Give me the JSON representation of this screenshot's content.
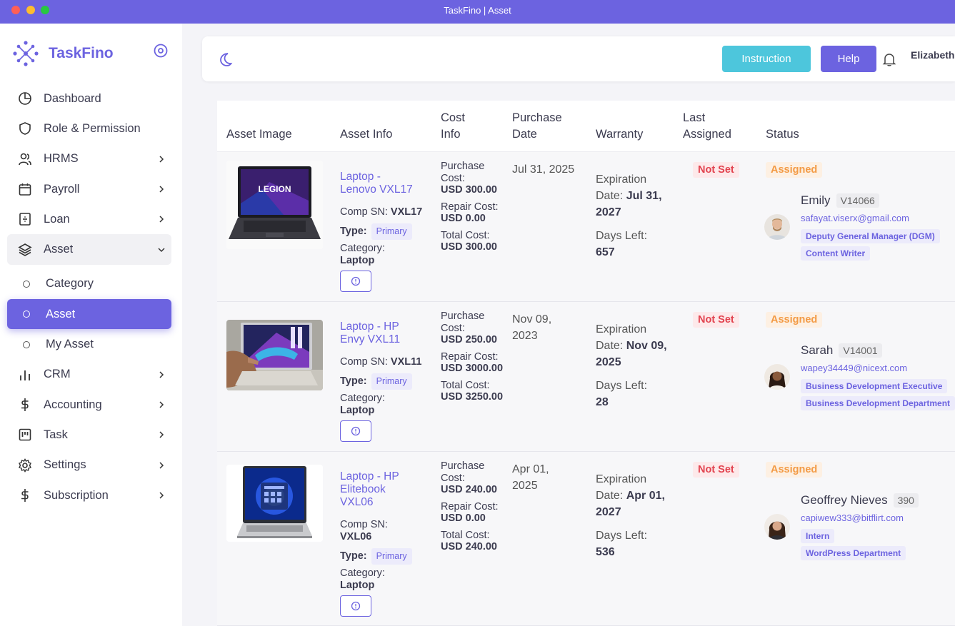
{
  "window": {
    "title": "TaskFino | Asset"
  },
  "brand": {
    "name": "TaskFino"
  },
  "nav": {
    "dashboard": "Dashboard",
    "role": "Role & Permission",
    "hrms": "HRMS",
    "payroll": "Payroll",
    "loan": "Loan",
    "asset": "Asset",
    "category": "Category",
    "asset_sub": "Asset",
    "my_asset": "My Asset",
    "crm": "CRM",
    "accounting": "Accounting",
    "task": "Task",
    "settings": "Settings",
    "subscription": "Subscription"
  },
  "header": {
    "instruction": "Instruction",
    "help": "Help",
    "user": "Elizabeth"
  },
  "table": {
    "columns": {
      "asset_image": "Asset Image",
      "asset_info": "Asset Info",
      "cost_l1": "Cost",
      "cost_l2": "Info",
      "purchase_l1": "Purchase",
      "purchase_l2": "Date",
      "warranty": "Warranty",
      "last_l1": "Last",
      "last_l2": "Assigned",
      "status": "Status"
    },
    "rows": [
      {
        "title_l1": "Laptop -",
        "title_l2": "Lenovo VXL17",
        "comp_sn_label": "Comp SN:",
        "comp_sn": "VXL17",
        "type_label": "Type:",
        "type": "Primary",
        "category_label": "Category:",
        "category": "Laptop",
        "image_text": "LEGION",
        "purchase_cost_label": "Purchase Cost:",
        "purchase_cost": "USD 300.00",
        "repair_cost_label": "Repair Cost:",
        "repair_cost": "USD 0.00",
        "total_cost_label": "Total Cost:",
        "total_cost": "USD 300.00",
        "purchase_date": "Jul 31, 2025",
        "expiration_label": "Expiration Date:",
        "expiration": "Jul 31, 2027",
        "days_left_label": "Days Left:",
        "days_left": "657",
        "last_assigned": "Not Set",
        "status": "Assigned",
        "emp_name": "Emily",
        "emp_code": "V14066",
        "emp_email": "safayat.viserx@gmail.com",
        "tag1": "Deputy General Manager (DGM)",
        "tag2": "Content Writer"
      },
      {
        "title_l1": "Laptop - HP",
        "title_l2": "Envy VXL11",
        "comp_sn_label": "Comp SN:",
        "comp_sn": "VXL11",
        "type_label": "Type:",
        "type": "Primary",
        "category_label": "Category:",
        "category": "Laptop",
        "purchase_cost_label": "Purchase Cost:",
        "purchase_cost": "USD 250.00",
        "repair_cost_label": "Repair Cost:",
        "repair_cost": "USD 3000.00",
        "total_cost_label": "Total Cost:",
        "total_cost": "USD 3250.00",
        "purchase_date": "Nov 09, 2023",
        "expiration_label": "Expiration Date:",
        "expiration": "Nov 09, 2025",
        "days_left_label": "Days Left:",
        "days_left": "28",
        "last_assigned": "Not Set",
        "status": "Assigned",
        "emp_name": "Sarah",
        "emp_code": "V14001",
        "emp_email": "wapey34449@nicext.com",
        "tag1": "Business Development Executive",
        "tag2": "Business Development Department"
      },
      {
        "title_l1": "Laptop - HP",
        "title_l2": "Elitebook",
        "title_l3": "VXL06",
        "comp_sn_label": "Comp SN:",
        "comp_sn": "VXL06",
        "type_label": "Type:",
        "type": "Primary",
        "category_label": "Category:",
        "category": "Laptop",
        "purchase_cost_label": "Purchase Cost:",
        "purchase_cost": "USD 240.00",
        "repair_cost_label": "Repair Cost:",
        "repair_cost": "USD 0.00",
        "total_cost_label": "Total Cost:",
        "total_cost": "USD 240.00",
        "purchase_date": "Apr 01, 2025",
        "expiration_label": "Expiration Date:",
        "expiration": "Apr 01, 2027",
        "days_left_label": "Days Left:",
        "days_left": "536",
        "last_assigned": "Not Set",
        "status": "Assigned",
        "emp_name": "Geoffrey Nieves",
        "emp_code": "390",
        "emp_email": "capiwew333@bitflirt.com",
        "tag1": "Intern",
        "tag2": "WordPress Department"
      }
    ]
  },
  "colors": {
    "accent": "#6c63e0",
    "instruction": "#4dc6dc",
    "danger": "#e2434f",
    "warning": "#f39b46"
  }
}
